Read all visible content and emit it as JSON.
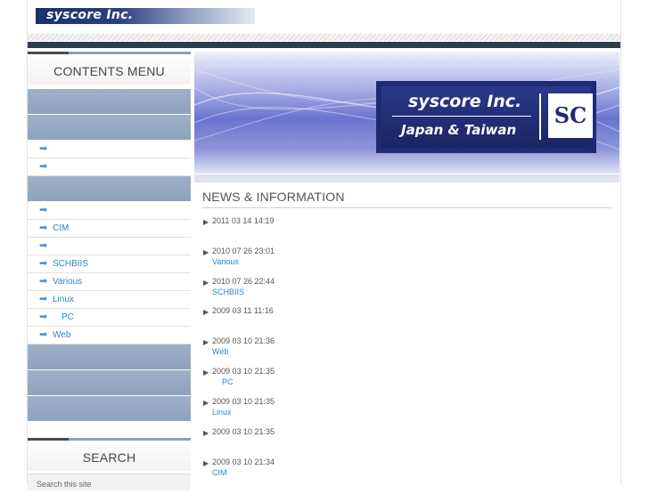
{
  "header": {
    "logo_text": "syscore Inc."
  },
  "sidebar": {
    "contents_title": "CONTENTS MENU",
    "search_title": "SEARCH",
    "search_placeholder": "Search this site",
    "items": [
      "",
      "",
      "",
      "CIM",
      "",
      "SCHBIIS",
      "Various",
      "Linux",
      "PC",
      "Web"
    ]
  },
  "banner": {
    "name": "syscore Inc.",
    "subtitle": "Japan & Taiwan",
    "mark": "SC"
  },
  "news": {
    "title": "NEWS & INFORMATION",
    "items": [
      {
        "date": "2011 03 14  14:19",
        "link": ""
      },
      {
        "date": "2010 07 26  23:01",
        "link": "Various"
      },
      {
        "date": "2010 07 26  22:44",
        "link": "SCHBIIS"
      },
      {
        "date": "2009 03 11  11:16",
        "link": ""
      },
      {
        "date": "2009 03 10  21:36",
        "link": "Web"
      },
      {
        "date": "2009 03 10  21:35",
        "link": "PC"
      },
      {
        "date": "2009 03 10  21:35",
        "link": "Linux"
      },
      {
        "date": "2009 03 10  21:35",
        "link": ""
      },
      {
        "date": "2009 03 10  21:34",
        "link": "CIM"
      }
    ]
  },
  "colors": {
    "link": "#2a86c6",
    "menu_block": "#9eb0c8",
    "dark_bar": "#2d3e4b",
    "logo_bar": "#1c2f6e"
  }
}
